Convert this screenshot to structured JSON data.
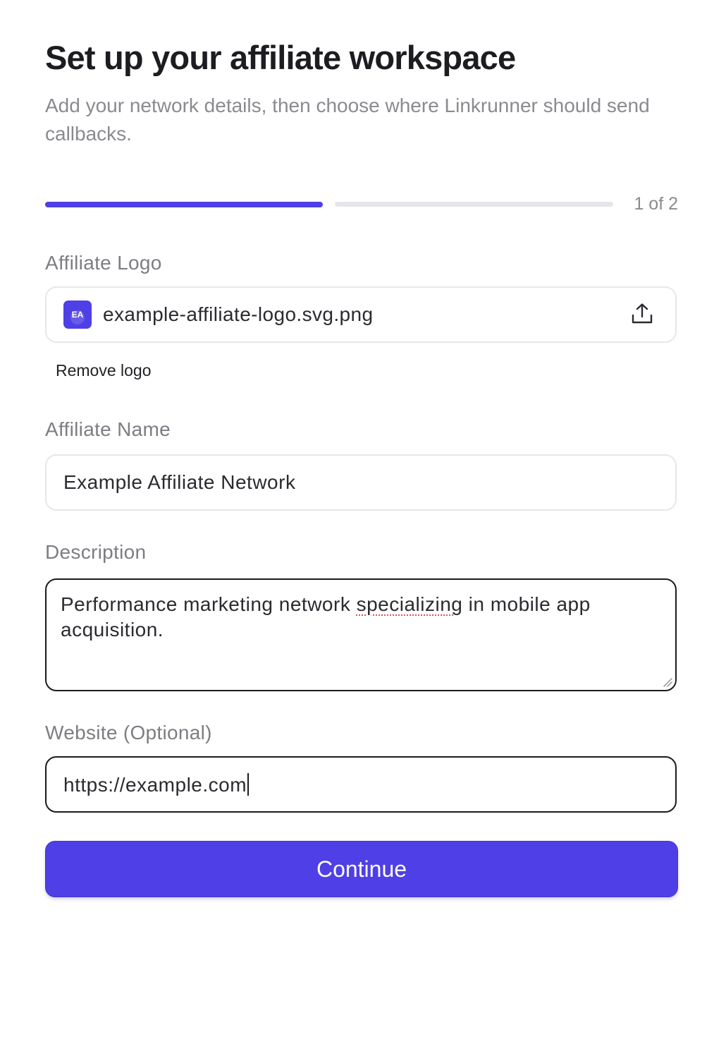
{
  "header": {
    "title": "Set up your affiliate workspace",
    "subtitle": "Add your network details, then choose where Linkrunner should send callbacks."
  },
  "progress": {
    "step_text": "1 of 2",
    "current_step": 1,
    "total_steps": 2
  },
  "form": {
    "logo": {
      "label": "Affiliate Logo",
      "thumb_initials": "EA",
      "file_name": "example-affiliate-logo.svg.png",
      "upload_icon": "upload-icon",
      "remove_label": "Remove logo"
    },
    "name": {
      "label": "Affiliate Name",
      "value": "Example Affiliate Network"
    },
    "description": {
      "label": "Description",
      "value_before": "Performance marketing network ",
      "value_misspelled": "specializing",
      "value_after": " in mobile app acquisition."
    },
    "website": {
      "label": "Website (Optional)",
      "value": "https://example.com"
    }
  },
  "actions": {
    "continue_label": "Continue"
  },
  "colors": {
    "accent": "#4f3fe6",
    "track": "#e6e6ea",
    "muted_text": "#8a8a90",
    "spellcheck_underline": "#e0524f"
  }
}
